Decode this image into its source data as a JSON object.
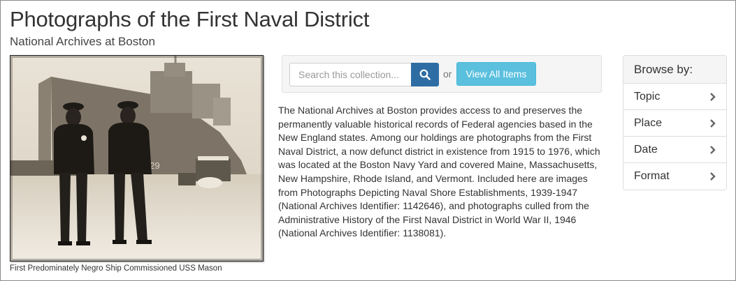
{
  "page": {
    "title": "Photographs of the First Naval District",
    "subtitle": "National Archives at Boston"
  },
  "photo": {
    "caption": "First Predominately Negro Ship Commissioned USS Mason",
    "hull_number": "529"
  },
  "search": {
    "placeholder": "Search this collection...",
    "button_icon": "search-icon",
    "or_label": "or",
    "view_all_label": "View All Items",
    "colors": {
      "search_button": "#2e6da4",
      "view_all": "#5bc0de"
    }
  },
  "description": "The National Archives at Boston provides access to and preserves the permanently valuable historical records of Federal agencies based in the New England states. Among our holdings are photographs from the First Naval District, a now defunct district in existence from 1915 to 1976, which was located at the Boston Navy Yard and covered Maine, Massachusetts, New Hampshire, Rhode Island, and Vermont. Included here are images from Photographs Depicting Naval Shore Establishments, 1939-1947 (National Archives Identifier: 1142646), and photographs culled from the Administrative History of the First Naval District in World War II, 1946 (National Archives Identifier: 1138081).",
  "browse": {
    "heading": "Browse by:",
    "items": [
      {
        "label": "Topic",
        "icon": "chevron-right-icon"
      },
      {
        "label": "Place",
        "icon": "chevron-right-icon"
      },
      {
        "label": "Date",
        "icon": "chevron-right-icon"
      },
      {
        "label": "Format",
        "icon": "chevron-right-icon"
      }
    ]
  }
}
